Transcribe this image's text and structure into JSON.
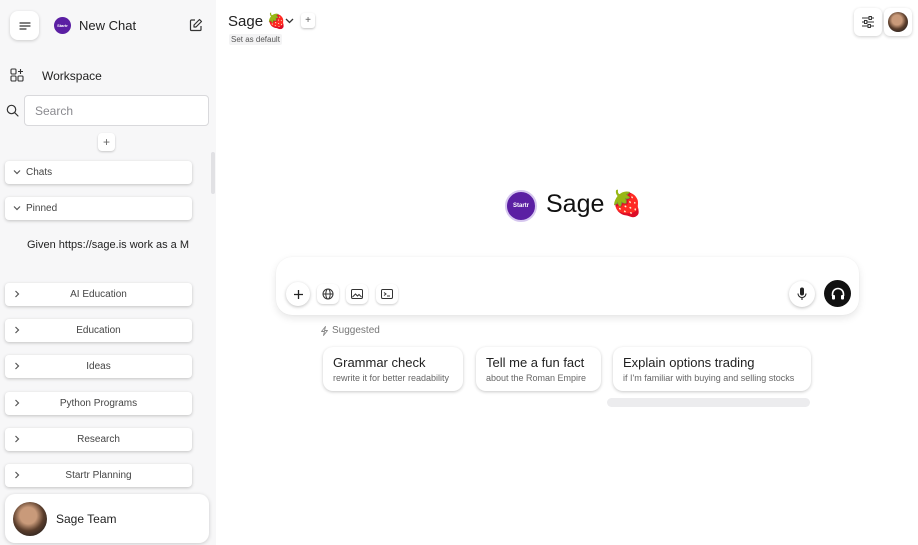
{
  "sidebar": {
    "new_chat_label": "New Chat",
    "logo_text": "Startr",
    "workspace_label": "Workspace",
    "search_placeholder": "Search",
    "add_folder_label": "+",
    "folders_top": [
      {
        "label": "Chats",
        "expanded": true
      },
      {
        "label": "Pinned",
        "expanded": true
      }
    ],
    "pinned_item": "Given https://sage.is work as a M",
    "folders": [
      {
        "label": "AI Education"
      },
      {
        "label": "Education"
      },
      {
        "label": "Ideas"
      },
      {
        "label": "Python Programs"
      },
      {
        "label": "Research"
      },
      {
        "label": "Startr Planning"
      }
    ],
    "user_name": "Sage Team"
  },
  "topbar": {
    "model_name": "Sage 🍓",
    "add_model_label": "+",
    "set_default_label": "Set as default"
  },
  "main": {
    "logo_text": "Startr",
    "title": "Sage 🍓",
    "suggested_label": "Suggested",
    "suggestions": [
      {
        "title": "Grammar check",
        "subtitle": "rewrite it for better readability"
      },
      {
        "title": "Tell me a fun fact",
        "subtitle": "about the Roman Empire"
      },
      {
        "title": "Explain options trading",
        "subtitle": "if I'm familiar with buying and selling stocks"
      }
    ]
  },
  "colors": {
    "brand_purple": "#5b1fa3",
    "sidebar_bg": "#f7f7f8",
    "voice_button": "#111111"
  }
}
